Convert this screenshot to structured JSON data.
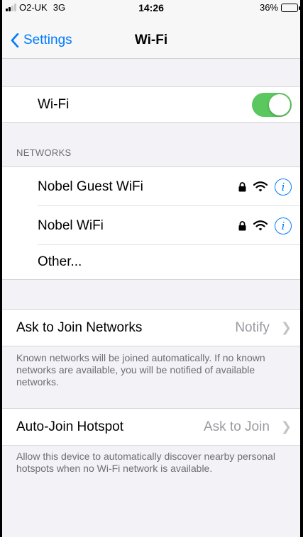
{
  "status_bar": {
    "carrier": "O2-UK",
    "network": "3G",
    "time": "14:26",
    "battery": "36%",
    "battery_level": 0.36
  },
  "nav": {
    "back_label": "Settings",
    "title": "Wi-Fi"
  },
  "wifi_toggle": {
    "label": "Wi-Fi",
    "on": true
  },
  "networks": {
    "header": "NETWORKS",
    "items": [
      {
        "name": "Nobel Guest WiFi",
        "locked": true
      },
      {
        "name": "Nobel WiFi",
        "locked": true
      }
    ],
    "other_label": "Other..."
  },
  "ask_to_join": {
    "label": "Ask to Join Networks",
    "value": "Notify",
    "footer": "Known networks will be joined automatically. If no known networks are available, you will be notified of available networks."
  },
  "auto_join_hotspot": {
    "label": "Auto-Join Hotspot",
    "value": "Ask to Join",
    "footer": "Allow this device to automatically discover nearby personal hotspots when no Wi-Fi network is available."
  },
  "colors": {
    "accent": "#007aff",
    "toggle_on": "#5ac85e",
    "background": "#f2f2f7"
  },
  "icons": [
    "signal-icon",
    "battery-icon",
    "back-chevron-icon",
    "lock-icon",
    "wifi-icon",
    "info-icon",
    "chevron-right-icon"
  ]
}
